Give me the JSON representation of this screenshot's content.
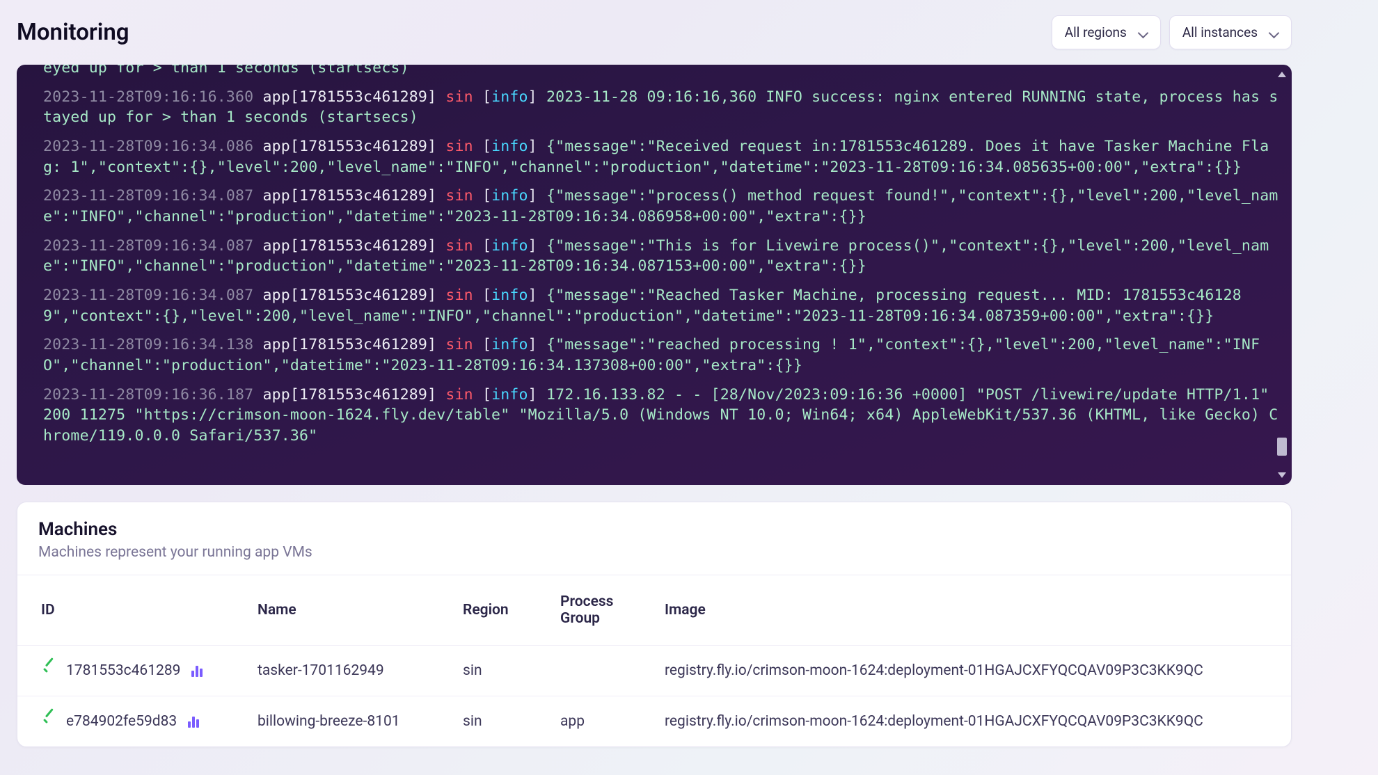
{
  "header": {
    "title": "Monitoring"
  },
  "filters": {
    "region_label": "All regions",
    "instances_label": "All instances"
  },
  "logs": [
    {
      "ts": "",
      "app": "",
      "region": "",
      "level": "",
      "msg": "eyed up for > than 1 seconds (startsecs)",
      "partial": true
    },
    {
      "ts": "2023-11-28T09:16:16.360",
      "app": "app[1781553c461289]",
      "region": "sin",
      "level": "info",
      "msg": "2023-11-28 09:16:16,360 INFO success: nginx entered RUNNING state, process has stayed up for > than 1 seconds (startsecs)"
    },
    {
      "ts": "2023-11-28T09:16:34.086",
      "app": "app[1781553c461289]",
      "region": "sin",
      "level": "info",
      "msg": "{\"message\":\"Received request in:1781553c461289. Does it have Tasker Machine Flag: 1\",\"context\":{},\"level\":200,\"level_name\":\"INFO\",\"channel\":\"production\",\"datetime\":\"2023-11-28T09:16:34.085635+00:00\",\"extra\":{}}"
    },
    {
      "ts": "2023-11-28T09:16:34.087",
      "app": "app[1781553c461289]",
      "region": "sin",
      "level": "info",
      "msg": "{\"message\":\"process() method request found!\",\"context\":{},\"level\":200,\"level_name\":\"INFO\",\"channel\":\"production\",\"datetime\":\"2023-11-28T09:16:34.086958+00:00\",\"extra\":{}}"
    },
    {
      "ts": "2023-11-28T09:16:34.087",
      "app": "app[1781553c461289]",
      "region": "sin",
      "level": "info",
      "msg": "{\"message\":\"This is for Livewire process()\",\"context\":{},\"level\":200,\"level_name\":\"INFO\",\"channel\":\"production\",\"datetime\":\"2023-11-28T09:16:34.087153+00:00\",\"extra\":{}}"
    },
    {
      "ts": "2023-11-28T09:16:34.087",
      "app": "app[1781553c461289]",
      "region": "sin",
      "level": "info",
      "msg": "{\"message\":\"Reached Tasker Machine, processing request... MID: 1781553c461289\",\"context\":{},\"level\":200,\"level_name\":\"INFO\",\"channel\":\"production\",\"datetime\":\"2023-11-28T09:16:34.087359+00:00\",\"extra\":{}}"
    },
    {
      "ts": "2023-11-28T09:16:34.138",
      "app": "app[1781553c461289]",
      "region": "sin",
      "level": "info",
      "msg": "{\"message\":\"reached processing ! 1\",\"context\":{},\"level\":200,\"level_name\":\"INFO\",\"channel\":\"production\",\"datetime\":\"2023-11-28T09:16:34.137308+00:00\",\"extra\":{}}"
    },
    {
      "ts": "2023-11-28T09:16:36.187",
      "app": "app[1781553c461289]",
      "region": "sin",
      "level": "info",
      "msg": "172.16.133.82 - - [28/Nov/2023:09:16:36 +0000] \"POST /livewire/update HTTP/1.1\" 200 11275 \"https://crimson-moon-1624.fly.dev/table\" \"Mozilla/5.0 (Windows NT 10.0; Win64; x64) AppleWebKit/537.36 (KHTML, like Gecko) Chrome/119.0.0.0 Safari/537.36\""
    }
  ],
  "machines": {
    "title": "Machines",
    "subtitle": "Machines represent your running app VMs",
    "columns": {
      "id": "ID",
      "name": "Name",
      "region": "Region",
      "process_group": "Process Group",
      "image": "Image"
    },
    "rows": [
      {
        "id": "1781553c461289",
        "name": "tasker-1701162949",
        "region": "sin",
        "process_group": "",
        "image": "registry.fly.io/crimson-moon-1624:deployment-01HGAJCXFYQCQAV09P3C3KK9QC"
      },
      {
        "id": "e784902fe59d83",
        "name": "billowing-breeze-8101",
        "region": "sin",
        "process_group": "app",
        "image": "registry.fly.io/crimson-moon-1624:deployment-01HGAJCXFYQCQAV09P3C3KK9QC"
      }
    ]
  }
}
